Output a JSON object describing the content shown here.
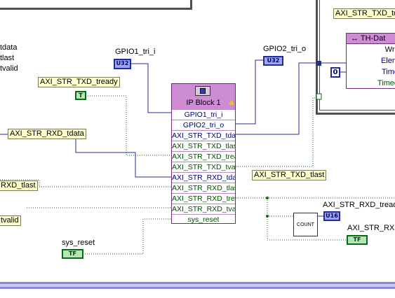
{
  "left_partial": {
    "rows": [
      "tdata",
      "tlast",
      "tvalid"
    ],
    "tag_rxd_tlast": "RXD_tlast",
    "tag_tvalid": "tvalid"
  },
  "controls": {
    "gpio1_label": "GPIO1_tri_i",
    "gpio1_type": "U32",
    "gpio2_label": "GPIO2_tri_o",
    "gpio2_type": "U32",
    "txd_tready_label": "AXI_STR_TXD_tready",
    "txd_tready_type": "T",
    "rxd_tdata_label": "AXI_STR_RXD_tdata",
    "txd_tlast_label": "AXI_STR_TXD_tlast",
    "sys_reset_label": "sys_reset",
    "sys_reset_type": "TF",
    "rxd_tready_label": "AXI_STR_RXD_tready",
    "rxd_tready_type": "U16",
    "rxd_tvalid_label": "AXI_STR_RXD_",
    "rxd_tvalid_type": "TF",
    "count_label": "COUNT",
    "zero_const": "0"
  },
  "ip_block": {
    "title": "IP Block 1",
    "rows": [
      {
        "label": "GPIO1_tri_i",
        "kind": "blue"
      },
      {
        "label": "GPIO2_tri_o",
        "kind": "blue"
      },
      {
        "label": "AXI_STR_TXD_tdat",
        "kind": "blue"
      },
      {
        "label": "AXI_STR_TXD_tlast",
        "kind": "green"
      },
      {
        "label": "AXI_STR_TXD_tread",
        "kind": "green"
      },
      {
        "label": "AXI_STR_TXD_tvali",
        "kind": "green"
      },
      {
        "label": "AXI_STR_RXD_tdat",
        "kind": "blue"
      },
      {
        "label": "AXI_STR_RXD_tlast",
        "kind": "green"
      },
      {
        "label": "AXI_STR_RXD_tread",
        "kind": "green"
      },
      {
        "label": "AXI_STR_RXD_tvali",
        "kind": "green"
      },
      {
        "label": "sys_reset",
        "kind": "green"
      }
    ]
  },
  "top_right": {
    "txd_tag": "AXI_STR_TXD_td",
    "th_title": "TH-Dat",
    "th_rows": [
      "Writ",
      "Elem",
      "Time",
      "Timed"
    ]
  },
  "colors": {
    "wire_blue": "#1f2b9e",
    "wire_green": "#0b6a1a",
    "node_purple": "#ce8cd4",
    "label_yellow": "#ffffcc"
  }
}
